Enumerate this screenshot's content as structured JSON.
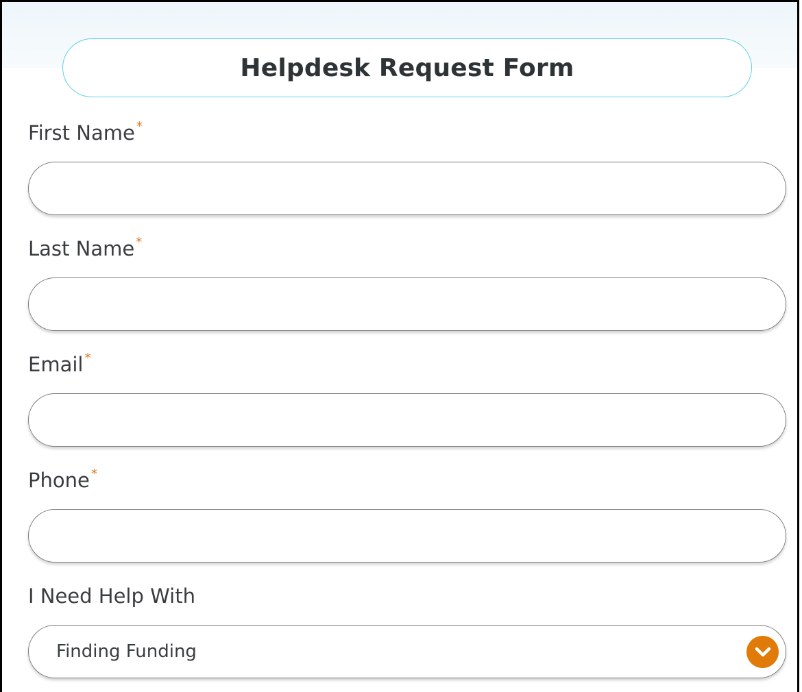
{
  "form": {
    "title": "Helpdesk Request Form",
    "required_marker": "*",
    "fields": {
      "first_name": {
        "label": "First Name",
        "value": "",
        "required": true
      },
      "last_name": {
        "label": "Last Name",
        "value": "",
        "required": true
      },
      "email": {
        "label": "Email",
        "value": "",
        "required": true
      },
      "phone": {
        "label": "Phone",
        "value": "",
        "required": true
      }
    },
    "help_with": {
      "label": "I Need Help With",
      "selected": "Finding Funding",
      "icon": "chevron-down-circle-icon"
    }
  },
  "colors": {
    "title_border": "#5fcfe8",
    "required_asterisk": "#e07b2a",
    "dropdown_button": "#e07b0a",
    "input_border": "#7b7f82"
  }
}
